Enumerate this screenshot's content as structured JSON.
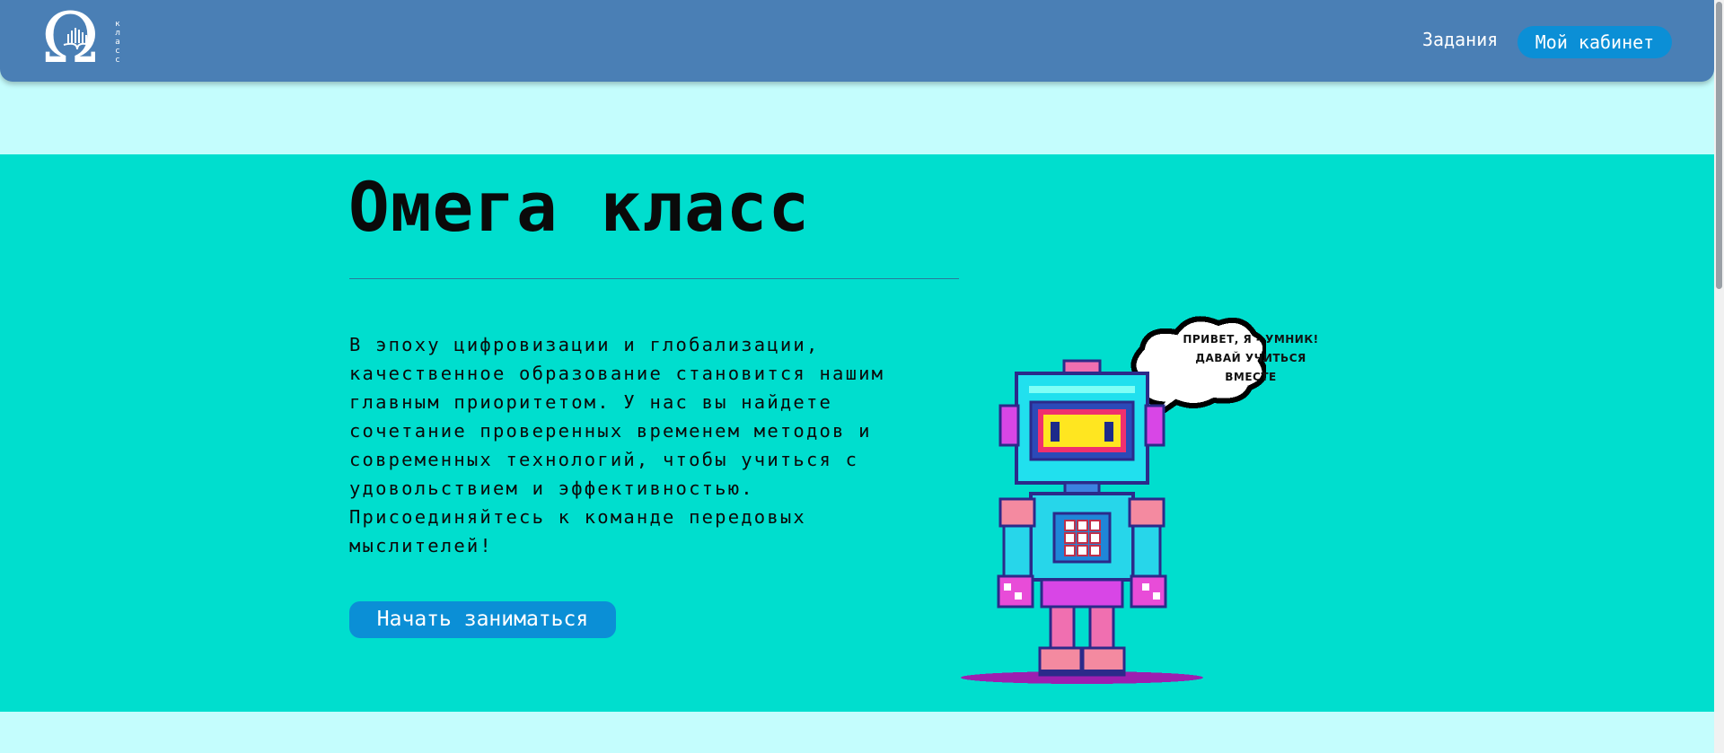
{
  "header": {
    "logo_side_text": "класс",
    "nav_link": "Задания",
    "cabinet_button": "Мой кабинет"
  },
  "hero": {
    "title": "Омега класс",
    "description": "В эпоху цифровизации и глобализации, качественное образование становится нашим главным приоритетом. У нас вы найдете сочетание проверенных временем методов и современных технологий, чтобы учиться с удовольствием и эффективностью. Присоединяйтесь к команде передовых мыслителей!",
    "start_button": "Начать заниматься",
    "speech_bubble": "ПРИВЕТ, Я - УМНИК! ДАВАЙ УЧИТЬСЯ ВМЕСТЕ"
  },
  "icons": {
    "logo": "omega-logo-icon",
    "robot": "pixel-robot-illustration",
    "bubble": "speech-bubble-icon"
  },
  "colors": {
    "header": "#4a7fb5",
    "page_bg": "#c4fdfd",
    "hero_bg": "#00dece",
    "accent_button": "#0b8fd6",
    "text": "#0a0a0a"
  }
}
